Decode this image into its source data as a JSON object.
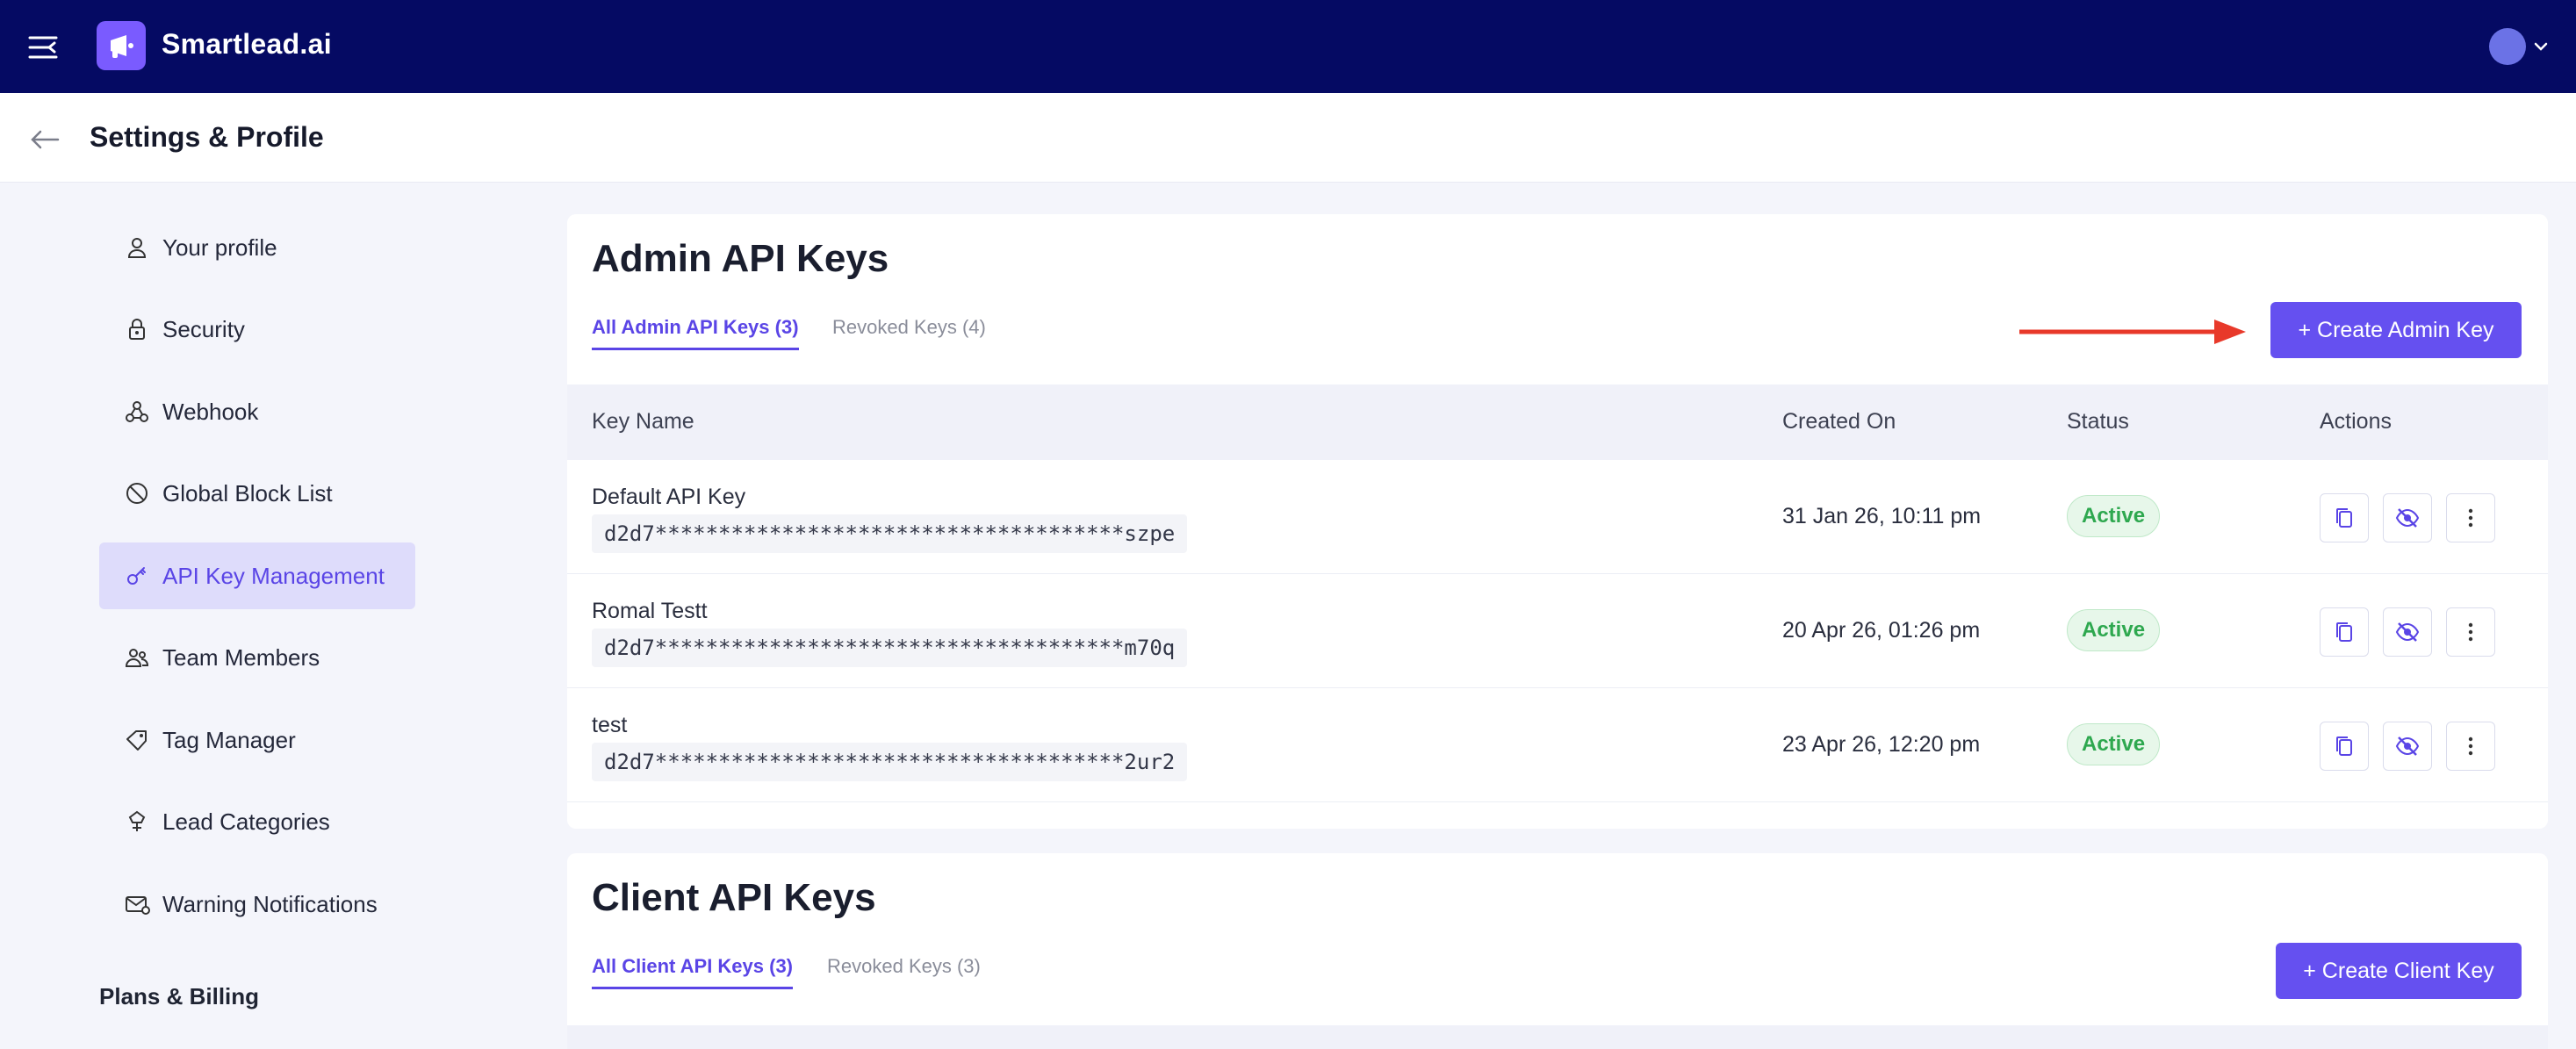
{
  "app": {
    "brand": "Smartlead.ai",
    "colors": {
      "topbar": "#050a63",
      "accent": "#6550f0",
      "active_green": "#2ea84f"
    }
  },
  "header": {
    "title": "Settings & Profile"
  },
  "sidebar": {
    "items": [
      {
        "label": "Your profile",
        "icon": "user-icon"
      },
      {
        "label": "Security",
        "icon": "lock-icon"
      },
      {
        "label": "Webhook",
        "icon": "webhook-icon"
      },
      {
        "label": "Global Block List",
        "icon": "block-icon"
      },
      {
        "label": "API Key Management",
        "icon": "key-icon",
        "active": true
      },
      {
        "label": "Team Members",
        "icon": "team-icon"
      },
      {
        "label": "Tag Manager",
        "icon": "tag-icon"
      },
      {
        "label": "Lead Categories",
        "icon": "lead-icon"
      },
      {
        "label": "Warning Notifications",
        "icon": "mail-warning-icon"
      }
    ],
    "section": "Plans & Billing"
  },
  "admin": {
    "title": "Admin API Keys",
    "tabs": [
      "All Admin API Keys (3)",
      "Revoked Keys (4)"
    ],
    "create_label": "+ Create Admin Key",
    "columns": [
      "Key Name",
      "Created On",
      "Status",
      "Actions"
    ],
    "rows": [
      {
        "name": "Default API Key",
        "key": "d2d7*************************************szpe",
        "created": "31 Jan 26, 10:11 pm",
        "status": "Active"
      },
      {
        "name": "Romal Testt",
        "key": "d2d7*************************************m70q",
        "created": "20 Apr 26, 01:26 pm",
        "status": "Active"
      },
      {
        "name": "test",
        "key": "d2d7*************************************2ur2",
        "created": "23 Apr 26, 12:20 pm",
        "status": "Active"
      }
    ]
  },
  "client": {
    "title": "Client API Keys",
    "tabs": [
      "All Client API Keys (3)",
      "Revoked Keys (3)"
    ],
    "create_label": "+ Create Client Key"
  }
}
